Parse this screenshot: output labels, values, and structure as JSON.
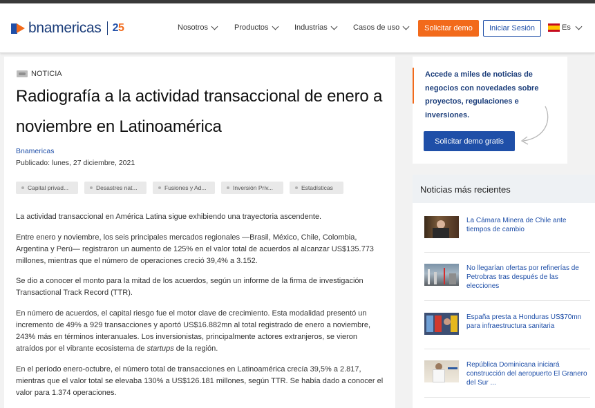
{
  "header": {
    "brand": "bnamericas",
    "brand_badge_a": "2",
    "brand_badge_b": "5",
    "nav": [
      {
        "label": "Nosotros"
      },
      {
        "label": "Productos"
      },
      {
        "label": "Industrias"
      },
      {
        "label": "Casos de uso"
      }
    ],
    "demo_button": "Solicitar demo",
    "login_button": "Iniciar Sesión",
    "language": "Es"
  },
  "article": {
    "kicker": "NOTICIA",
    "title": "Radiografía a la actividad transaccional de enero a noviembre en Latinoamérica",
    "author": "Bnamericas",
    "published": "Publicado: lunes, 27 diciembre, 2021",
    "tags": [
      "Capital privad...",
      "Desastres nat...",
      "Fusiones y Ad...",
      "Inversión Priv...",
      "Estadísticas"
    ],
    "paragraphs": [
      "La actividad transaccional en América Latina sigue exhibiendo una trayectoria ascendente.",
      "Entre enero y noviembre, los seis principales mercados regionales —Brasil, México, Chile, Colombia, Argentina y Perú— registraron un aumento de 125% en el valor total de acuerdos al alcanzar US$135.773 millones, mientras que el número de operaciones creció 39,4% a 3.152.",
      "Se dio a conocer el monto para la mitad de los acuerdos, según un informe de la firma de investigación Transactional Track Record (TTR).",
      "En número de acuerdos, el capital riesgo fue el motor clave de crecimiento. Esta modalidad presentó un incremento de 49% a 929 transacciones y aportó US$16.882mn al total registrado de enero a noviembre, 243% más en términos interanuales. Los inversionistas, principalmente actores extranjeros, se vieron atraídos por el vibrante ecosistema de",
      "startups",
      "de la región.",
      "En el período enero-octubre, el número total de transacciones en Latinoamérica crecía 39,5% a 2.817, mientras que el valor total se elevaba 130% a US$126.181 millones, según TTR. Se había dado a conocer el valor para 1.374 operaciones."
    ]
  },
  "promo": {
    "text": "Accede a miles de noticias de negocios con novedades sobre proyectos, regulaciones e inversiones.",
    "button": "Solicitar demo gratis"
  },
  "recent": {
    "title": "Noticias más recientes",
    "items": [
      {
        "title": "La Cámara Minera de Chile ante tiempos de cambio"
      },
      {
        "title": "No llegarían ofertas por refinerías de Petrobras tras después de las elecciones"
      },
      {
        "title": "España presta a Honduras US$70mn para infraestructura sanitaria"
      },
      {
        "title": "República Dominicana iniciará construcción del aeropuerto El Granero del Sur ..."
      }
    ]
  },
  "colors": {
    "brand_blue": "#1f4fa8",
    "brand_orange": "#f26a1b",
    "link_blue": "#1f4fa8"
  }
}
